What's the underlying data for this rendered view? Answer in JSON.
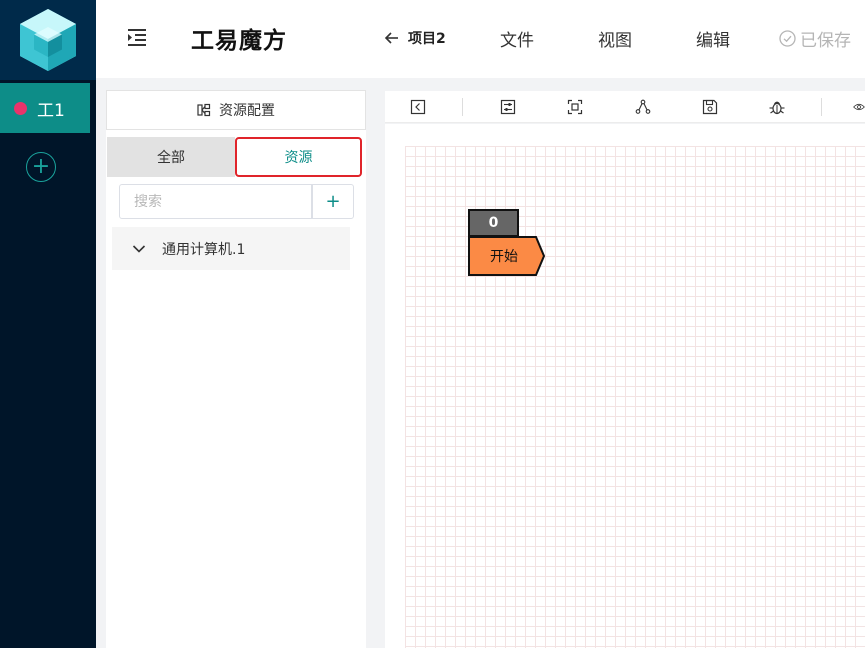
{
  "rail": {
    "work_label": "工1",
    "add_label": "+"
  },
  "header": {
    "title": "工易魔方",
    "project": "项目2",
    "nav": [
      "文件",
      "视图",
      "编辑"
    ],
    "saved_label": "已保存"
  },
  "panel": {
    "title": "资源配置",
    "tabs": [
      "全部",
      "资源"
    ],
    "active_tab": "资源",
    "search_placeholder": "搜索",
    "search_add_label": "+",
    "tree_items": [
      "通用计算机.1"
    ]
  },
  "toolbar": {
    "icons": [
      "collapse-icon",
      "settings-sliders-icon",
      "fit-screen-icon",
      "share-nodes-icon",
      "save-icon",
      "bug-icon",
      "eye-icon"
    ]
  },
  "canvas": {
    "node": {
      "badge": "0",
      "label": "开始"
    }
  },
  "colors": {
    "rail_bg": "#001529",
    "accent": "#0d8d88",
    "node_fill": "#fb8a45",
    "highlight_border": "#e0242a"
  }
}
